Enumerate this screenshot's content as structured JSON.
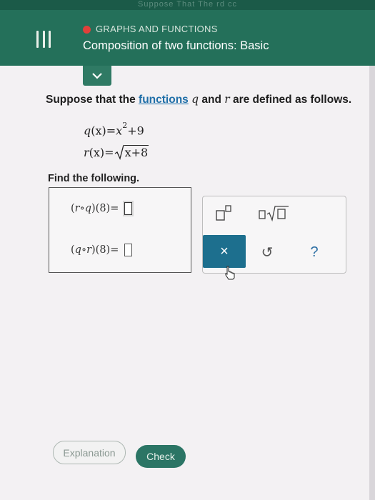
{
  "header": {
    "top_strip_text": "Suppose That The rd cc",
    "category": "GRAPHS AND FUNCTIONS",
    "lesson_title": "Composition of two functions: Basic"
  },
  "problem": {
    "prompt_start": "Suppose that the ",
    "prompt_link": "functions",
    "var_q": "q",
    "prompt_and": " and ",
    "var_r": "r",
    "prompt_end": " are defined as follows.",
    "eq1_lhs": "q",
    "eq1_arg": "(x)",
    "eq1_eq": "=",
    "eq1_base": "x",
    "eq1_exp": "2",
    "eq1_tail": "+9",
    "eq2_lhs": "r",
    "eq2_arg": "(x)",
    "eq2_eq": "=",
    "eq2_radicand": "x+8",
    "find_label": "Find the following."
  },
  "answers": [
    {
      "expr_open": "(",
      "outer": "r",
      "circ": " ∘",
      "inner": "q",
      "close_arg": ")(8)",
      "eq": " ="
    },
    {
      "expr_open": "(",
      "outer": "q",
      "circ": " ∘",
      "inner": "r",
      "close_arg": ")(8)",
      "eq": " ="
    }
  ],
  "keypad": {
    "clear_symbol": "×",
    "undo_symbol": "↺",
    "help_symbol": "?"
  },
  "footer": {
    "explanation_label": "Explanation",
    "check_label": "Check"
  },
  "colors": {
    "header": "#24705a",
    "accent_blue": "#1d6f8e",
    "check_button": "#2b7565",
    "category_dot": "#e0403a"
  }
}
